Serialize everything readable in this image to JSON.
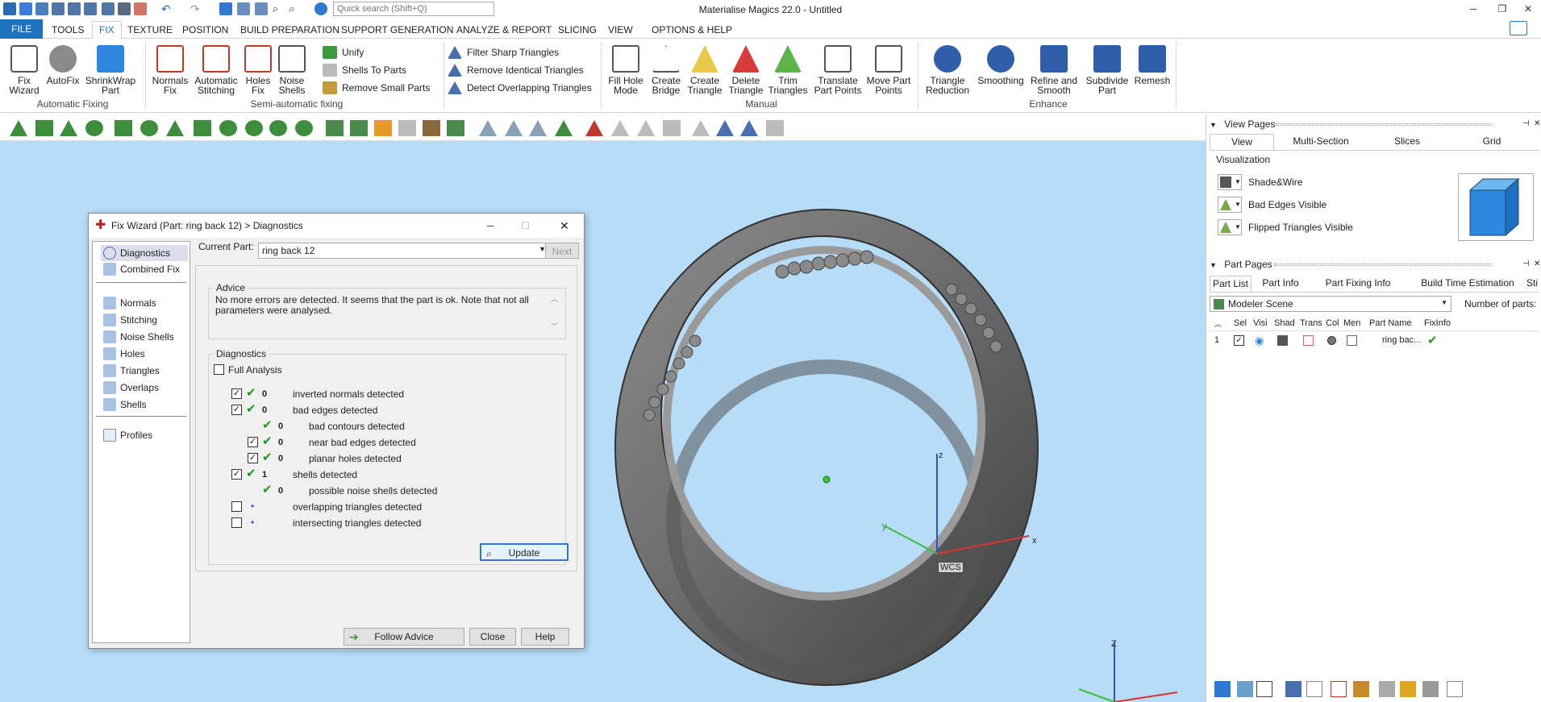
{
  "app": {
    "title": "Materialise Magics 22.0 - Untitled",
    "search_placeholder": "Quick search (Shift+Q)",
    "win_min": "─",
    "win_max": "❐",
    "win_close": "✕"
  },
  "menu_tabs": [
    "FILE",
    "TOOLS",
    "FIX",
    "TEXTURE",
    "POSITION",
    "BUILD PREPARATION",
    "SUPPORT GENERATION",
    "ANALYZE & REPORT",
    "SLICING",
    "VIEW",
    "OPTIONS & HELP"
  ],
  "ribbon": {
    "automatic": {
      "group": "Automatic Fixing",
      "buttons": [
        {
          "l1": "Fix",
          "l2": "Wizard"
        },
        {
          "l1": "AutoFix",
          "l2": ""
        },
        {
          "l1": "ShrinkWrap",
          "l2": "Part"
        }
      ]
    },
    "semiauto": {
      "group": "Semi-automatic fixing",
      "buttons": [
        {
          "l1": "Normals",
          "l2": "Fix"
        },
        {
          "l1": "Automatic",
          "l2": "Stitching"
        },
        {
          "l1": "Holes",
          "l2": "Fix"
        },
        {
          "l1": "Noise",
          "l2": "Shells"
        }
      ],
      "small": [
        "Unify",
        "Shells To Parts",
        "Remove Small Parts"
      ]
    },
    "triangles_small": [
      "Filter Sharp Triangles",
      "Remove Identical Triangles",
      "Detect Overlapping Triangles"
    ],
    "manual": {
      "group": "Manual",
      "buttons": [
        {
          "l1": "Fill Hole",
          "l2": "Mode"
        },
        {
          "l1": "Create",
          "l2": "Bridge"
        },
        {
          "l1": "Create",
          "l2": "Triangle"
        },
        {
          "l1": "Delete",
          "l2": "Triangle"
        },
        {
          "l1": "Trim",
          "l2": "Triangles"
        },
        {
          "l1": "Translate",
          "l2": "Part Points"
        },
        {
          "l1": "Move Part",
          "l2": "Points"
        }
      ]
    },
    "enhance": {
      "group": "Enhance",
      "buttons": [
        {
          "l1": "Triangle",
          "l2": "Reduction"
        },
        {
          "l1": "Smoothing",
          "l2": ""
        },
        {
          "l1": "Refine and",
          "l2": "Smooth"
        },
        {
          "l1": "Subdivide",
          "l2": "Part"
        },
        {
          "l1": "Remesh",
          "l2": ""
        }
      ]
    }
  },
  "dialog": {
    "title": "Fix Wizard (Part: ring back 12) > Diagnostics",
    "nav": [
      "Diagnostics",
      "Combined Fix",
      "Normals",
      "Stitching",
      "Noise Shells",
      "Holes",
      "Triangles",
      "Overlaps",
      "Shells",
      "Profiles"
    ],
    "current_part_label": "Current Part:",
    "current_part": "ring back 12",
    "next": "Next",
    "advice_legend": "Advice",
    "advice": "No more errors are detected. It seems that the part is ok. Note that not all parameters were analysed.",
    "diag_legend": "Diagnostics",
    "full_analysis": "Full Analysis",
    "rows": [
      {
        "count": "0",
        "label": "inverted normals detected"
      },
      {
        "count": "0",
        "label": "bad edges detected"
      },
      {
        "count": "0",
        "label": "bad contours detected"
      },
      {
        "count": "0",
        "label": "near bad edges detected"
      },
      {
        "count": "0",
        "label": "planar holes detected"
      },
      {
        "count": "1",
        "label": "shells detected"
      },
      {
        "count": "0",
        "label": "possible noise shells detected"
      },
      {
        "count": "",
        "label": "overlapping triangles detected"
      },
      {
        "count": "",
        "label": "intersecting triangles detected"
      }
    ],
    "update": "Update",
    "follow_advice": "Follow Advice",
    "close": "Close",
    "help": "Help"
  },
  "viewport": {
    "axis_z": "z",
    "axis_y": "y",
    "axis_x": "x",
    "wcs": "WCS",
    "axis_z2": "Z"
  },
  "view_pages": {
    "title": "View Pages",
    "tabs": [
      "View",
      "Multi-Section",
      "Slices",
      "Grid"
    ],
    "visualization": "Visualization",
    "items": [
      "Shade&Wire",
      "Bad Edges Visible",
      "Flipped Triangles Visible"
    ]
  },
  "part_pages": {
    "title": "Part Pages",
    "tabs": [
      "Part List",
      "Part Info",
      "Part Fixing Info",
      "Build Time Estimation",
      "Sti"
    ],
    "scene": "Modeler Scene",
    "num_parts_label": "Number of parts:",
    "columns": [
      "Sel",
      "Visi",
      "Shad",
      "Trans",
      "Col",
      "Men",
      "Part Name",
      "FixInfo"
    ],
    "row": {
      "index": "1",
      "name": "ring bac..."
    }
  },
  "colors": {
    "accent": "#1e73be",
    "viewport": "#b6dcf7",
    "ok": "#1f9a1f"
  }
}
